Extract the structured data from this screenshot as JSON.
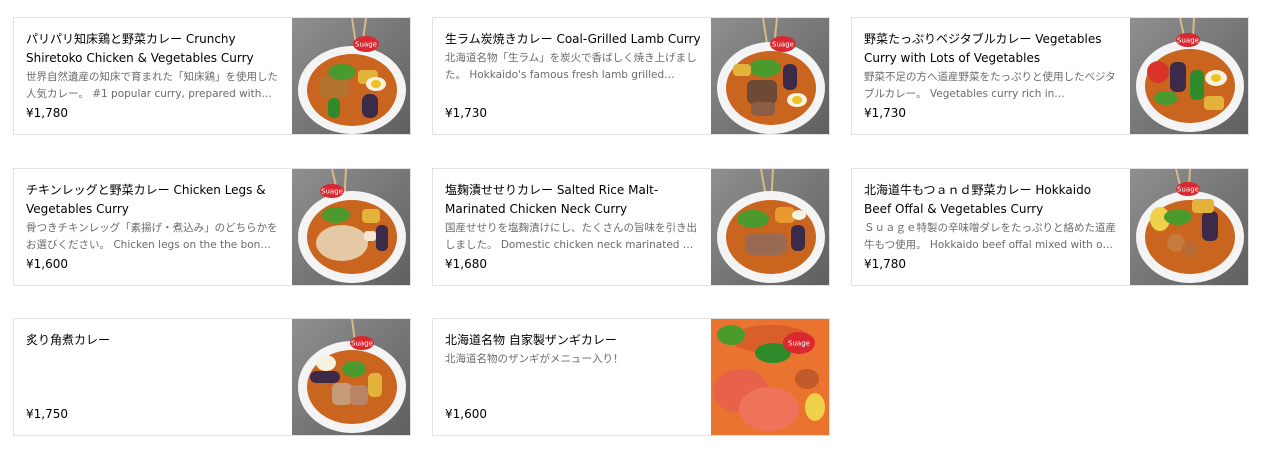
{
  "menu_items": [
    {
      "title": "パリパリ知床鶏と野菜カレー Crunchy Shiretoko Chicken & Vegetables Curry",
      "description": "世界自然遺産の知床で育まれた「知床鶏」を使用した人気カレー。 #1 popular curry, prepared with…",
      "price": "¥1,780",
      "image": "soup-curry-chicken-photo"
    },
    {
      "title": "生ラム炭焼きカレー Coal-Grilled Lamb Curry",
      "description": "北海道名物「生ラム」を炭火で香ばしく焼き上げました。 Hokkaido's famous fresh lamb grilled…",
      "price": "¥1,730",
      "image": "soup-curry-lamb-photo"
    },
    {
      "title": "野菜たっぷりベジタブルカレー Vegetables Curry with Lots of Vegetables",
      "description": "野菜不足の方へ道産野菜をたっぷりと使用したベジタブルカレー。 Vegetables curry rich in…",
      "price": "¥1,730",
      "image": "soup-curry-vegetables-photo"
    },
    {
      "title": "チキンレッグと野菜カレー Chicken Legs & Vegetables Curry",
      "description": "骨つきチキンレッグ「素揚げ・煮込み」のどちらかをお選びください。 Chicken legs on the the bon…",
      "price": "¥1,600",
      "image": "soup-curry-chicken-leg-photo"
    },
    {
      "title": "塩麹漬せせりカレー Salted Rice Malt-Marinated Chicken Neck Curry",
      "description": "国産せせりを塩麹漬けにし、たくさんの旨味を引き出しました。 Domestic chicken neck marinated …",
      "price": "¥1,680",
      "image": "soup-curry-chicken-neck-photo"
    },
    {
      "title": "北海道牛もつａｎｄ野菜カレー Hokkaido Beef Offal & Vegetables Curry",
      "description": "Ｓｕａｇｅ特製の辛味噌ダレをたっぷりと絡めた道産牛もつ使用。 Hokkaido beef offal mixed with o…",
      "price": "¥1,780",
      "image": "soup-curry-beef-offal-photo"
    },
    {
      "title": "炙り角煮カレー",
      "description": "",
      "price": "¥1,750",
      "image": "soup-curry-pork-belly-photo"
    },
    {
      "title": "北海道名物 自家製ザンギカレー",
      "description": "北海道名物のザンギがメニュー入り！",
      "price": "¥1,600",
      "image": "soup-curry-zangi-photo"
    }
  ],
  "bowl_logo_text": "Suage",
  "colors": {
    "card_border": "#e2e2e2",
    "description_text": "#6b6b6b",
    "curry_broth": "#c9651f",
    "logo_red": "#d9282f"
  }
}
